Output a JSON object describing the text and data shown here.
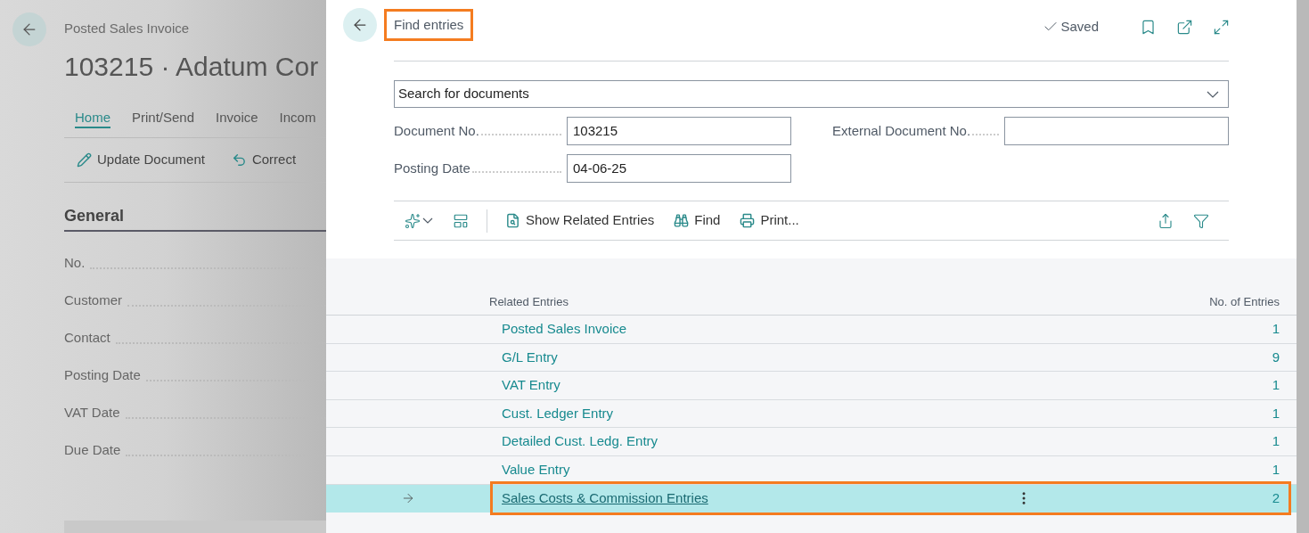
{
  "background_page": {
    "breadcrumb": "Posted Sales Invoice",
    "title": "103215 · Adatum Cor",
    "tabs": [
      {
        "label": "Home",
        "selected": true
      },
      {
        "label": "Print/Send",
        "selected": false
      },
      {
        "label": "Invoice",
        "selected": false
      },
      {
        "label": "Incom",
        "selected": false
      }
    ],
    "actions": [
      {
        "kind": "edit",
        "label": "Update Document"
      },
      {
        "kind": "undo",
        "label": "Correct"
      }
    ],
    "section_title": "General",
    "fields": [
      "No.",
      "Customer",
      "Contact",
      "Posting Date",
      "VAT Date",
      "Due Date"
    ]
  },
  "dialog": {
    "title": "Find entries",
    "title_highlighted": true,
    "status": "Saved",
    "search_type": {
      "value": "Search for documents"
    },
    "fields": [
      {
        "label": "Document No.",
        "value": "103215"
      },
      {
        "label": "External Document No."
      },
      {
        "label": "Posting Date",
        "value": "04-06-25"
      }
    ],
    "toolbar": [
      {
        "kind": "show-related",
        "label": "Show Related Entries"
      },
      {
        "kind": "find",
        "label": "Find"
      },
      {
        "kind": "print",
        "label": "Print..."
      }
    ],
    "table": {
      "columns": [
        "Related Entries",
        "No. of Entries"
      ],
      "rows": [
        {
          "name": "Posted Sales Invoice",
          "count": "1",
          "selected": false,
          "highlighted": false
        },
        {
          "name": "G/L Entry",
          "count": "9",
          "selected": false,
          "highlighted": false
        },
        {
          "name": "VAT Entry",
          "count": "1",
          "selected": false,
          "highlighted": false
        },
        {
          "name": "Cust. Ledger Entry",
          "count": "1",
          "selected": false,
          "highlighted": false
        },
        {
          "name": "Detailed Cust. Ledg. Entry",
          "count": "1",
          "selected": false,
          "highlighted": false
        },
        {
          "name": "Value Entry",
          "count": "1",
          "selected": false,
          "highlighted": false
        },
        {
          "name": "Sales Costs & Commission Entries",
          "count": "2",
          "selected": true,
          "highlighted": true
        }
      ]
    }
  }
}
